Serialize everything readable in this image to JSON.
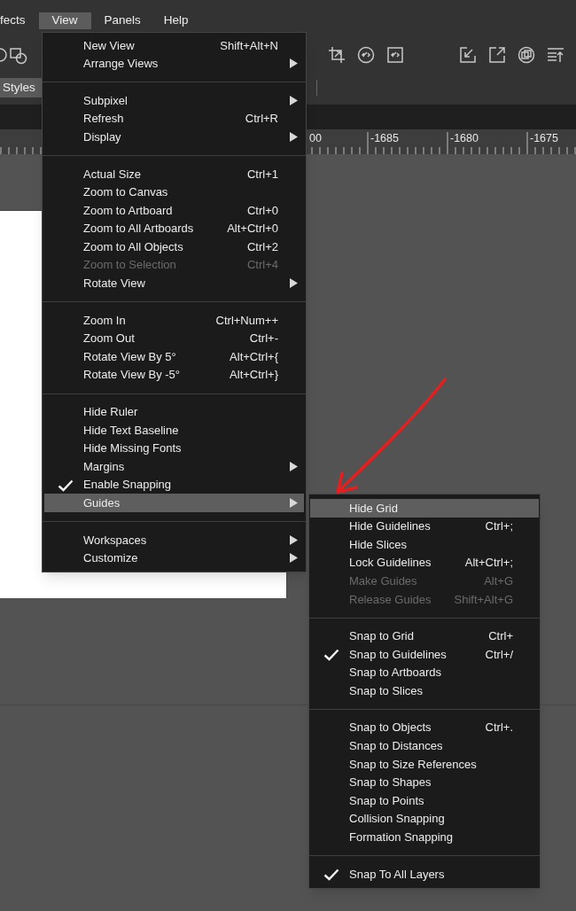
{
  "menubar": [
    {
      "label": "fects",
      "selected": false
    },
    {
      "label": "View",
      "selected": true
    },
    {
      "label": "Panels",
      "selected": false
    },
    {
      "label": "Help",
      "selected": false
    }
  ],
  "styles_tab": {
    "label": "Styles"
  },
  "ruler": {
    "labels": [
      "00",
      "-1685",
      "-1680",
      "-1675"
    ]
  },
  "view_menu": {
    "groups": [
      [
        {
          "label": "New View",
          "shortcut": "Shift+Alt+N",
          "submenu": false,
          "checked": false,
          "disabled": false,
          "selected": false
        },
        {
          "label": "Arrange Views",
          "submenu": true,
          "checked": false,
          "disabled": false,
          "selected": false
        }
      ],
      [
        {
          "label": "Subpixel",
          "submenu": true,
          "checked": false,
          "disabled": false,
          "selected": false
        },
        {
          "label": "Refresh",
          "shortcut": "Ctrl+R",
          "submenu": false,
          "checked": false,
          "disabled": false,
          "selected": false
        },
        {
          "label": "Display",
          "submenu": true,
          "checked": false,
          "disabled": false,
          "selected": false
        }
      ],
      [
        {
          "label": "Actual Size",
          "shortcut": "Ctrl+1",
          "submenu": false,
          "checked": false,
          "disabled": false,
          "selected": false
        },
        {
          "label": "Zoom to Canvas",
          "submenu": false,
          "checked": false,
          "disabled": false,
          "selected": false
        },
        {
          "label": "Zoom to Artboard",
          "shortcut": "Ctrl+0",
          "submenu": false,
          "checked": false,
          "disabled": false,
          "selected": false
        },
        {
          "label": "Zoom to All Artboards",
          "shortcut": "Alt+Ctrl+0",
          "submenu": false,
          "checked": false,
          "disabled": false,
          "selected": false
        },
        {
          "label": "Zoom to All Objects",
          "shortcut": "Ctrl+2",
          "submenu": false,
          "checked": false,
          "disabled": false,
          "selected": false
        },
        {
          "label": "Zoom to Selection",
          "shortcut": "Ctrl+4",
          "submenu": false,
          "checked": false,
          "disabled": true,
          "selected": false
        },
        {
          "label": "Rotate View",
          "submenu": true,
          "checked": false,
          "disabled": false,
          "selected": false
        }
      ],
      [
        {
          "label": "Zoom In",
          "shortcut": "Ctrl+Num++",
          "submenu": false,
          "checked": false,
          "disabled": false,
          "selected": false
        },
        {
          "label": "Zoom Out",
          "shortcut": "Ctrl+-",
          "submenu": false,
          "checked": false,
          "disabled": false,
          "selected": false
        },
        {
          "label": "Rotate View By 5°",
          "shortcut": "Alt+Ctrl+{",
          "submenu": false,
          "checked": false,
          "disabled": false,
          "selected": false
        },
        {
          "label": "Rotate View By -5°",
          "shortcut": "Alt+Ctrl+}",
          "submenu": false,
          "checked": false,
          "disabled": false,
          "selected": false
        }
      ],
      [
        {
          "label": "Hide Ruler",
          "submenu": false,
          "checked": false,
          "disabled": false,
          "selected": false
        },
        {
          "label": "Hide Text Baseline",
          "submenu": false,
          "checked": false,
          "disabled": false,
          "selected": false
        },
        {
          "label": "Hide Missing Fonts",
          "submenu": false,
          "checked": false,
          "disabled": false,
          "selected": false
        },
        {
          "label": "Margins",
          "submenu": true,
          "checked": false,
          "disabled": false,
          "selected": false
        },
        {
          "label": "Enable Snapping",
          "submenu": false,
          "checked": true,
          "disabled": false,
          "selected": false
        },
        {
          "label": "Guides",
          "submenu": true,
          "checked": false,
          "disabled": false,
          "selected": true
        }
      ],
      [
        {
          "label": "Workspaces",
          "submenu": true,
          "checked": false,
          "disabled": false,
          "selected": false
        },
        {
          "label": "Customize",
          "submenu": true,
          "checked": false,
          "disabled": false,
          "selected": false
        }
      ]
    ]
  },
  "guides_menu": {
    "groups": [
      [
        {
          "label": "Hide Grid",
          "submenu": false,
          "checked": false,
          "disabled": false,
          "selected": true
        },
        {
          "label": "Hide Guidelines",
          "shortcut": "Ctrl+;",
          "submenu": false,
          "checked": false,
          "disabled": false,
          "selected": false
        },
        {
          "label": "Hide Slices",
          "submenu": false,
          "checked": false,
          "disabled": false,
          "selected": false
        },
        {
          "label": "Lock Guidelines",
          "shortcut": "Alt+Ctrl+;",
          "submenu": false,
          "checked": false,
          "disabled": false,
          "selected": false
        },
        {
          "label": "Make Guides",
          "shortcut": "Alt+G",
          "submenu": false,
          "checked": false,
          "disabled": true,
          "selected": false
        },
        {
          "label": "Release Guides",
          "shortcut": "Shift+Alt+G",
          "submenu": false,
          "checked": false,
          "disabled": true,
          "selected": false
        }
      ],
      [
        {
          "label": "Snap to Grid",
          "shortcut": "Ctrl+",
          "submenu": false,
          "checked": false,
          "disabled": false,
          "selected": false
        },
        {
          "label": "Snap to Guidelines",
          "shortcut": "Ctrl+/",
          "submenu": false,
          "checked": true,
          "disabled": false,
          "selected": false
        },
        {
          "label": "Snap to Artboards",
          "submenu": false,
          "checked": false,
          "disabled": false,
          "selected": false
        },
        {
          "label": "Snap to Slices",
          "submenu": false,
          "checked": false,
          "disabled": false,
          "selected": false
        }
      ],
      [
        {
          "label": "Snap to Objects",
          "shortcut": "Ctrl+.",
          "submenu": false,
          "checked": false,
          "disabled": false,
          "selected": false
        },
        {
          "label": "Snap to Distances",
          "submenu": false,
          "checked": false,
          "disabled": false,
          "selected": false
        },
        {
          "label": "Snap to Size References",
          "submenu": false,
          "checked": false,
          "disabled": false,
          "selected": false
        },
        {
          "label": "Snap to Shapes",
          "submenu": false,
          "checked": false,
          "disabled": false,
          "selected": false
        },
        {
          "label": "Snap to Points",
          "submenu": false,
          "checked": false,
          "disabled": false,
          "selected": false
        },
        {
          "label": "Collision Snapping",
          "submenu": false,
          "checked": false,
          "disabled": false,
          "selected": false
        },
        {
          "label": "Formation Snapping",
          "submenu": false,
          "checked": false,
          "disabled": false,
          "selected": false
        }
      ],
      [
        {
          "label": "Snap To All Layers",
          "submenu": false,
          "checked": true,
          "disabled": false,
          "selected": false
        }
      ]
    ]
  }
}
